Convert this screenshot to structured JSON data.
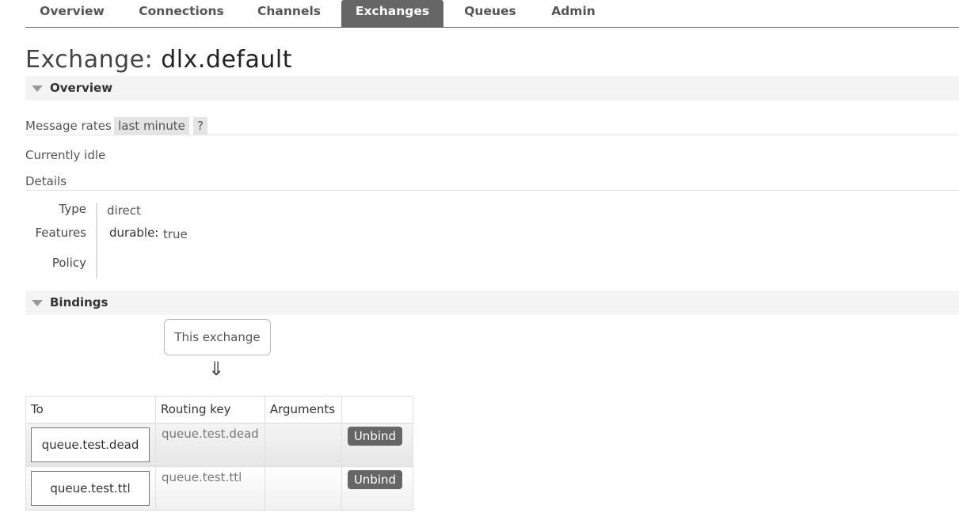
{
  "nav": {
    "tabs": [
      {
        "label": "Overview"
      },
      {
        "label": "Connections"
      },
      {
        "label": "Channels"
      },
      {
        "label": "Exchanges",
        "active": true
      },
      {
        "label": "Queues"
      },
      {
        "label": "Admin"
      }
    ]
  },
  "page": {
    "title_prefix": "Exchange:",
    "title_name": "dlx.default"
  },
  "overview": {
    "header": "Overview",
    "message_rates_label": "Message rates",
    "rate_period": "last minute",
    "help": "?",
    "idle_text": "Currently idle",
    "details_label": "Details",
    "details": {
      "type_label": "Type",
      "type_value": "direct",
      "features_label": "Features",
      "durable_label": "durable:",
      "durable_value": "true",
      "policy_label": "Policy"
    }
  },
  "bindings": {
    "header": "Bindings",
    "this_exchange": "This exchange",
    "arrow": "⇓",
    "columns": [
      "To",
      "Routing key",
      "Arguments",
      ""
    ],
    "rows": [
      {
        "to": "queue.test.dead",
        "routing_key": "queue.test.dead",
        "arguments": "",
        "action": "Unbind"
      },
      {
        "to": "queue.test.ttl",
        "routing_key": "queue.test.ttl",
        "arguments": "",
        "action": "Unbind"
      }
    ]
  },
  "colors": {
    "nav_active_bg": "#666666",
    "section_bg": "#f4f4f4",
    "button_bg": "#666666"
  }
}
